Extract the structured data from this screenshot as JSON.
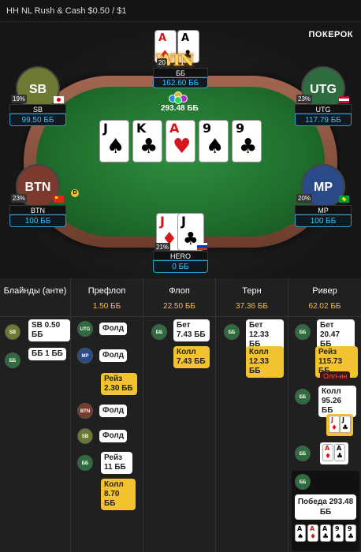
{
  "title": "HH NL Rush & Cash $0.50 / $1",
  "brand": "ПОКЕРОК",
  "win_text": "WIN",
  "pot": "293.48 ББ",
  "dealer": "D",
  "board": [
    {
      "rank": "J",
      "suit": "♠",
      "color": "black"
    },
    {
      "rank": "K",
      "suit": "♣",
      "color": "black"
    },
    {
      "rank": "A",
      "suit": "♥",
      "color": "red"
    },
    {
      "rank": "9",
      "suit": "♠",
      "color": "black"
    },
    {
      "rank": "9",
      "suit": "♣",
      "color": "black"
    }
  ],
  "seats": {
    "bb": {
      "name": "ББ",
      "stack": "162.60 ББ",
      "cards": [
        {
          "rank": "A",
          "suit": "♦",
          "color": "red"
        },
        {
          "rank": "A",
          "suit": "♣",
          "color": "black"
        }
      ],
      "pct": "20"
    },
    "sb": {
      "avatar": "SB",
      "name": "SB",
      "stack": "99.50 ББ",
      "pct": "19%",
      "color": "#7a8a3a"
    },
    "utg": {
      "avatar": "UTG",
      "name": "UTG",
      "stack": "117.79 ББ",
      "pct": "23%",
      "color": "#2e6b3e"
    },
    "btn": {
      "avatar": "BTN",
      "name": "BTN",
      "stack": "100 ББ",
      "pct": "23%",
      "color": "#7a3a2e"
    },
    "mp": {
      "avatar": "MP",
      "name": "MP",
      "stack": "100 ББ",
      "pct": "20%",
      "color": "#2a4a8a"
    },
    "hero": {
      "name": "HERO",
      "stack": "0 ББ",
      "pct": "21%",
      "cards": [
        {
          "rank": "J",
          "suit": "♦",
          "color": "red"
        },
        {
          "rank": "J",
          "suit": "♣",
          "color": "black"
        }
      ]
    }
  },
  "history": {
    "columns": [
      {
        "name": "Блайнды (анте)",
        "amount": ""
      },
      {
        "name": "Префлоп",
        "amount": "1.50 ББ"
      },
      {
        "name": "Флоп",
        "amount": "22.50 ББ"
      },
      {
        "name": "Терн",
        "amount": "37.36 ББ"
      },
      {
        "name": "Ривер",
        "amount": "62.02 ББ"
      }
    ],
    "blinds": [
      {
        "pos": "SB",
        "text": "SB 0.50 ББ"
      },
      {
        "pos": "ББ",
        "text": "ББ 1 ББ"
      }
    ],
    "preflop": [
      {
        "pos": "UTG",
        "text": "Фолд"
      },
      {
        "pos": "MP",
        "text": "Фолд"
      },
      {
        "pos": "",
        "text": "Рейз 2.30 ББ"
      },
      {
        "pos": "BTN",
        "text": "Фолд"
      },
      {
        "pos": "SB",
        "text": "Фолд"
      },
      {
        "pos": "ББ",
        "text": "Рейз 11 ББ"
      },
      {
        "pos": "",
        "text": "Колл 8.70 ББ"
      }
    ],
    "flop": [
      {
        "pos": "ББ",
        "text": "Бет 7.43 ББ"
      },
      {
        "pos": "",
        "text": "Колл 7.43 ББ"
      }
    ],
    "turn": [
      {
        "pos": "ББ",
        "text": "Бет 12.33 ББ"
      },
      {
        "pos": "",
        "text": "Колл 12.33 ББ"
      }
    ],
    "river": [
      {
        "pos": "ББ",
        "text": "Бет 20.47 ББ"
      },
      {
        "pos": "",
        "text": "Рейз 115.73 ББ",
        "badge": "Олл-ин"
      },
      {
        "pos": "ББ",
        "text": "Колл 95.26 ББ"
      },
      {
        "pos": "ББ",
        "text": ""
      },
      {
        "pos": "ББ",
        "text": "Победа 293.48 ББ"
      }
    ]
  }
}
